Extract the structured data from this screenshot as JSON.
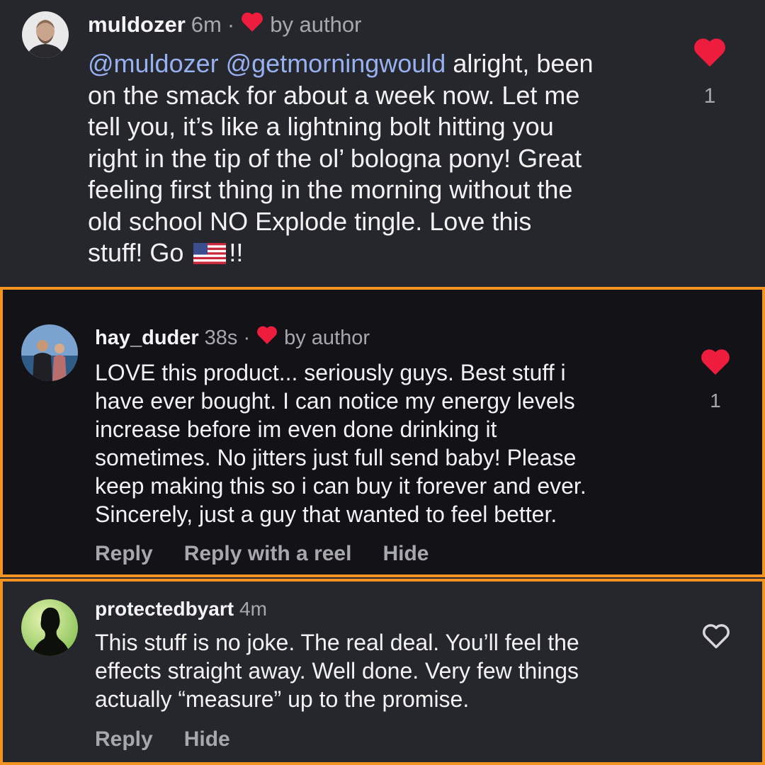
{
  "colors": {
    "background": "#26272d",
    "highlighted_background": "#121217",
    "highlight_border": "#f39322",
    "like_red": "#ee1d3e",
    "mention_blue": "#97b0f0",
    "muted_text": "#a7a8ad"
  },
  "comments": [
    {
      "username": "muldozer",
      "time": "6m",
      "dot": "·",
      "liked_by_author_label": "by author",
      "body": {
        "mentions": "@muldozer @getmorningwould",
        "lines": [
          "alright, been",
          "on the smack for about a week now. Let me",
          "tell you, it’s like a lightning bolt hitting you",
          "right in the tip of the ol’ bologna pony! Great",
          "feeling first thing in the morning without the",
          "old school NO Explode tingle. Love this",
          "stuff! Go",
          "!!"
        ],
        "flag_icon": "us-flag-icon"
      },
      "like_icon": "heart-filled-icon",
      "like_count": "1"
    },
    {
      "username": "hay_duder",
      "time": "38s",
      "dot": "·",
      "liked_by_author_label": "by author",
      "body_lines": [
        "LOVE this product... seriously guys. Best stuff i",
        "have ever bought. I can notice my energy levels",
        "increase before im even done drinking it",
        "sometimes. No jitters just full send baby! Please",
        "keep making this so i can buy it forever and ever.",
        "Sincerely, just a guy that wanted to feel better."
      ],
      "like_icon": "heart-filled-icon",
      "like_count": "1",
      "actions": {
        "reply": "Reply",
        "reply_reel": "Reply with a reel",
        "hide": "Hide"
      }
    },
    {
      "username": "protectedbyart",
      "time": "4m",
      "body_lines": [
        "This stuff is no joke. The real deal. You’ll feel the",
        "effects straight away. Well done. Very few things",
        "actually “measure” up to the promise."
      ],
      "like_icon": "heart-outline-icon",
      "actions": {
        "reply": "Reply",
        "hide": "Hide"
      }
    }
  ]
}
